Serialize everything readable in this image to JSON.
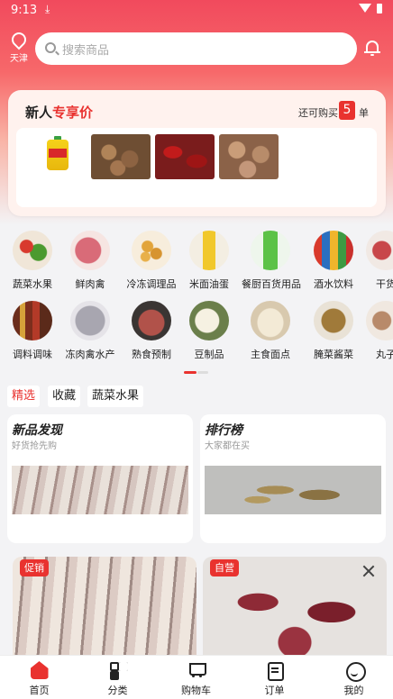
{
  "status_bar": {
    "time": "9:13"
  },
  "header": {
    "city": "天津",
    "search_placeholder": "搜索商品"
  },
  "promo": {
    "title_part1": "新人",
    "title_part2": "专享价",
    "remain_prefix": "还可购买",
    "remain_count": "5",
    "remain_unit": "单",
    "products": [
      "oil-jug",
      "mushrooms",
      "chili-peppers",
      "nuts"
    ]
  },
  "categories": [
    {
      "label": "蔬菜水果"
    },
    {
      "label": "鲜肉禽"
    },
    {
      "label": "冷冻调理品"
    },
    {
      "label": "米面油蛋"
    },
    {
      "label": "餐厨百货用品"
    },
    {
      "label": "酒水饮料"
    },
    {
      "label": "干货"
    },
    {
      "label": "调料调味"
    },
    {
      "label": "冻肉禽水产"
    },
    {
      "label": "熟食预制"
    },
    {
      "label": "豆制品"
    },
    {
      "label": "主食面点"
    },
    {
      "label": "腌菜酱菜"
    },
    {
      "label": "丸子"
    }
  ],
  "tabs": [
    {
      "label": "精选"
    },
    {
      "label": "收藏"
    },
    {
      "label": "蔬菜水果"
    }
  ],
  "cards": [
    {
      "title": "新品发现",
      "subtitle": "好货抢先购"
    },
    {
      "title": "排行榜",
      "subtitle": "大家都在买"
    }
  ],
  "feed": [
    {
      "badge": "促销"
    },
    {
      "badge": "自营"
    }
  ],
  "bottom_nav": [
    {
      "label": "首页"
    },
    {
      "label": "分类"
    },
    {
      "label": "购物车"
    },
    {
      "label": "订单"
    },
    {
      "label": "我的"
    }
  ],
  "colors": {
    "accent": "#e9322f",
    "hero": "#f14a5d"
  }
}
